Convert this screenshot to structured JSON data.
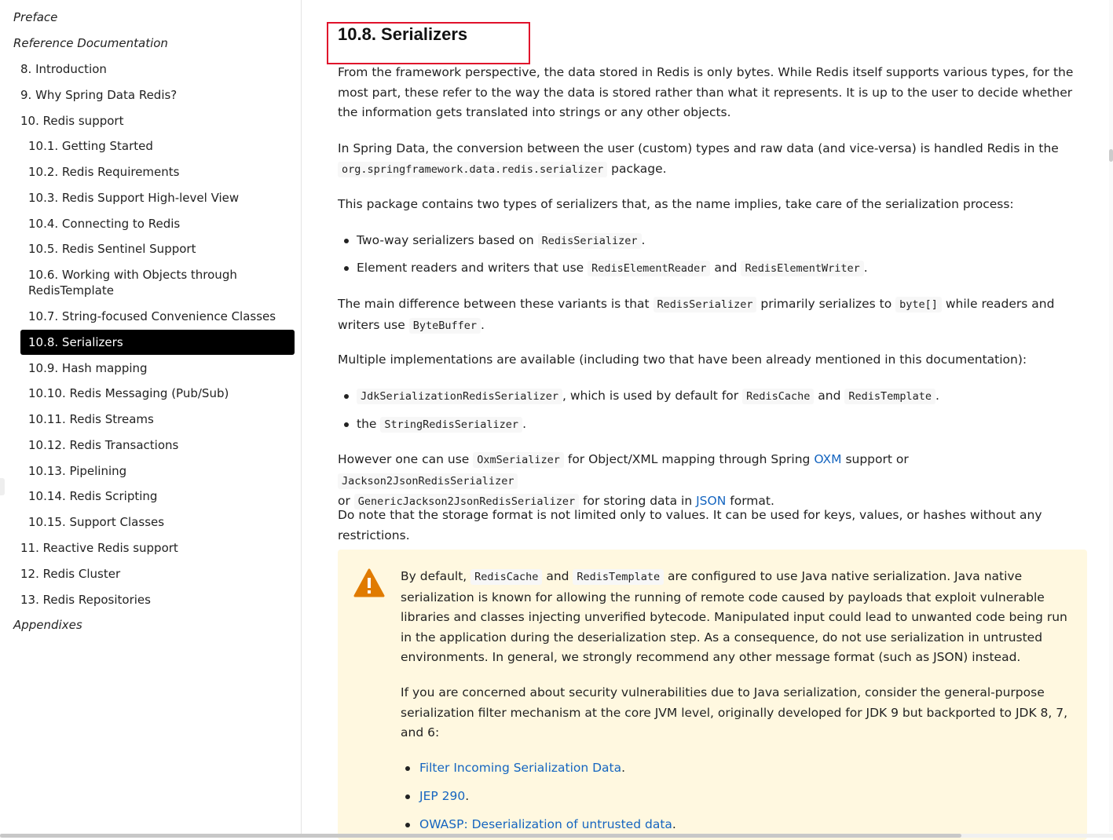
{
  "toc": {
    "items": [
      {
        "label": "Preface",
        "level": "top"
      },
      {
        "label": "Reference Documentation",
        "level": "top"
      },
      {
        "label": "8. Introduction",
        "level": "l1"
      },
      {
        "label": "9. Why Spring Data Redis?",
        "level": "l1"
      },
      {
        "label": "10. Redis support",
        "level": "l1"
      },
      {
        "label": "10.1. Getting Started",
        "level": "l2"
      },
      {
        "label": "10.2. Redis Requirements",
        "level": "l2"
      },
      {
        "label": "10.3. Redis Support High-level View",
        "level": "l2"
      },
      {
        "label": "10.4. Connecting to Redis",
        "level": "l2"
      },
      {
        "label": "10.5. Redis Sentinel Support",
        "level": "l2"
      },
      {
        "label": "10.6. Working with Objects through",
        "label2": "RedisTemplate",
        "level": "l2"
      },
      {
        "label": "10.7. String-focused Convenience Classes",
        "level": "l2"
      },
      {
        "label": "10.8. Serializers",
        "level": "active"
      },
      {
        "label": "10.9. Hash mapping",
        "level": "l2"
      },
      {
        "label": "10.10. Redis Messaging (Pub/Sub)",
        "level": "l2"
      },
      {
        "label": "10.11. Redis Streams",
        "level": "l2"
      },
      {
        "label": "10.12. Redis Transactions",
        "level": "l2"
      },
      {
        "label": "10.13. Pipelining",
        "level": "l2"
      },
      {
        "label": "10.14. Redis Scripting",
        "level": "l2"
      },
      {
        "label": "10.15. Support Classes",
        "level": "l2"
      },
      {
        "label": "11. Reactive Redis support",
        "level": "l1"
      },
      {
        "label": "12. Redis Cluster",
        "level": "l1"
      },
      {
        "label": "13. Redis Repositories",
        "level": "l1"
      },
      {
        "label": "Appendixes",
        "level": "top"
      }
    ]
  },
  "section": {
    "title": "10.8. Serializers",
    "p1": "From the framework perspective, the data stored in Redis is only bytes. While Redis itself supports various types, for the most part, these refer to the way the data is stored rather than what it represents. It is up to the user to decide whether the information gets translated into strings or any other objects.",
    "p2a": "In Spring Data, the conversion between the user (custom) types and raw data (and vice-versa) is handled Redis in the",
    "p2code": "org.springframework.data.redis.serializer",
    "p2b": " package.",
    "p3": "This package contains two types of serializers that, as the name implies, take care of the serialization process:",
    "b1a": "Two-way serializers based on ",
    "b1code": "RedisSerializer",
    "b1b": ".",
    "b2a": "Element readers and writers that use ",
    "b2code1": "RedisElementReader",
    "b2mid": " and ",
    "b2code2": "RedisElementWriter",
    "b2b": ".",
    "p4a": "The main difference between these variants is that ",
    "p4code1": "RedisSerializer",
    "p4mid": " primarily serializes to ",
    "p4code2": "byte[]",
    "p4mid2": " while readers and writers use ",
    "p4code3": "ByteBuffer",
    "p4b": ".",
    "p5": "Multiple implementations are available (including two that have been already mentioned in this documentation):",
    "b3code1": "JdkSerializationRedisSerializer",
    "b3mid": ", which is used by default for ",
    "b3code2": "RedisCache",
    "b3and": " and ",
    "b3code3": "RedisTemplate",
    "b3end": ".",
    "b4a": "the ",
    "b4code": "StringRedisSerializer",
    "b4end": ".",
    "p6a": "However one can use ",
    "p6code1": "OxmSerializer",
    "p6mid1": " for Object/XML mapping through Spring ",
    "p6link1": "OXM",
    "p6mid2": " support or ",
    "p6code2": "Jackson2JsonRedisSerializer",
    "p6or": " or ",
    "p6code3": "GenericJackson2JsonRedisSerializer",
    "p6mid3": " for storing data in ",
    "p6link2": "JSON",
    "p6end": " format.",
    "p7": "Do note that the storage format is not limited only to values. It can be used for keys, values, or hashes without any restrictions."
  },
  "warning": {
    "icon": "warning-icon",
    "w1a": "By default, ",
    "w1code1": "RedisCache",
    "w1and": " and ",
    "w1code2": "RedisTemplate",
    "w1b": " are configured to use Java native serialization. Java native serialization is known for allowing the running of remote code caused by payloads that exploit vulnerable libraries and classes injecting unverified bytecode. Manipulated input could lead to unwanted code being run in the application during the deserialization step. As a consequence, do not use serialization in untrusted environments. In general, we strongly recommend any other message format (such as JSON) instead.",
    "w2": "If you are concerned about security vulnerabilities due to Java serialization, consider the general-purpose serialization filter mechanism at the core JVM level, originally developed for JDK 9 but backported to JDK 8, 7, and 6:",
    "links": [
      "Filter Incoming Serialization Data",
      "JEP 290",
      "OWASP: Deserialization of untrusted data"
    ],
    "dot": "."
  },
  "colors": {
    "accent": "#1565c0",
    "highlight_box": "#e0112b",
    "admonition_bg": "#fff8e0",
    "warning_icon": "#e07b00"
  }
}
